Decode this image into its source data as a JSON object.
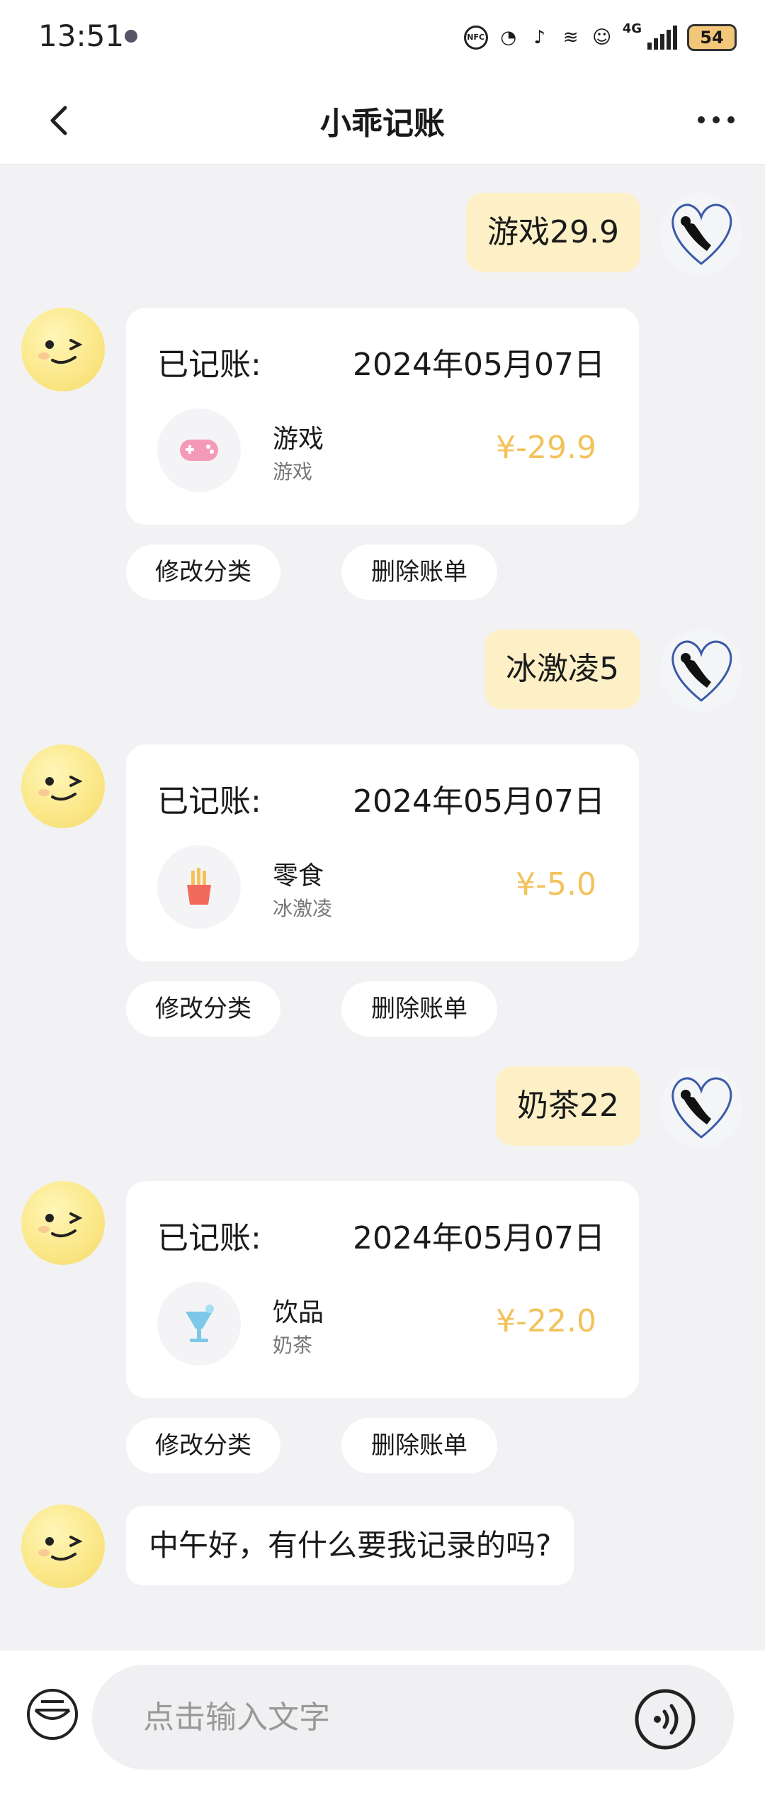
{
  "status": {
    "time": "13:51",
    "battery": "54",
    "network": "4G"
  },
  "header": {
    "title": "小乖记账"
  },
  "messages": [
    {
      "user_text": "游戏29.9",
      "card": {
        "label": "已记账:",
        "date": "2024年05月07日",
        "category": "游戏",
        "note": "游戏",
        "amount": "¥-29.9",
        "icon": "gamepad-icon"
      }
    },
    {
      "user_text": "冰激凌5",
      "card": {
        "label": "已记账:",
        "date": "2024年05月07日",
        "category": "零食",
        "note": "冰激凌",
        "amount": "¥-5.0",
        "icon": "fries-icon"
      }
    },
    {
      "user_text": "奶茶22",
      "card": {
        "label": "已记账:",
        "date": "2024年05月07日",
        "category": "饮品",
        "note": "奶茶",
        "amount": "¥-22.0",
        "icon": "drink-icon"
      }
    }
  ],
  "actions": {
    "edit_category": "修改分类",
    "delete_bill": "删除账单"
  },
  "bot_greeting": "中午好，有什么要我记录的吗?",
  "input": {
    "placeholder": "点击输入文字"
  },
  "colors": {
    "amount": "#f3c25c",
    "user_bubble": "#fdf0c6",
    "background": "#f2f2f4"
  }
}
